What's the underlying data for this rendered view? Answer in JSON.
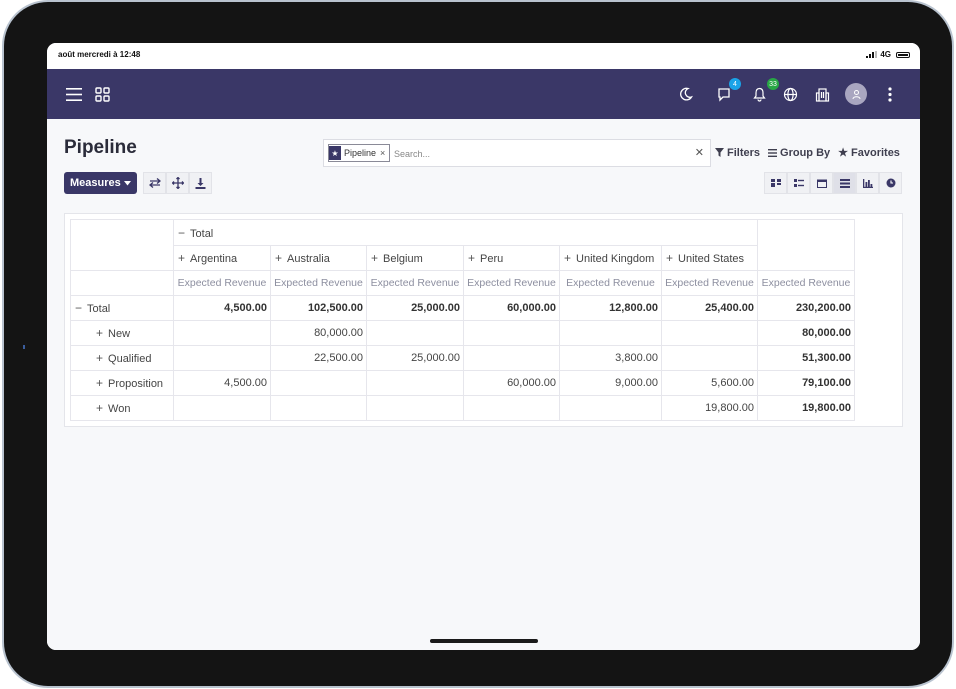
{
  "status_bar": {
    "time": "août mercredi à 12:48",
    "network": "4G"
  },
  "navbar": {
    "menu_icon": "hamburger-icon",
    "apps_icon": "grid-apps-icon",
    "moon_icon": "moon-icon",
    "chat_badge": "4",
    "notification_badge": "33",
    "colors": {
      "navbar_bg": "#3a3767",
      "chat_badge": "#1aa3e8",
      "notification_badge": "#28a745"
    }
  },
  "page": {
    "title": "Pipeline",
    "search": {
      "facet_label": "Pipeline",
      "placeholder": "Search..."
    },
    "controls": {
      "filters": "Filters",
      "group_by": "Group By",
      "favorites": "Favorites"
    },
    "measures_label": "Measures"
  },
  "pivot": {
    "total_header": "Total",
    "columns": [
      "Argentina",
      "Australia",
      "Belgium",
      "Peru",
      "United Kingdom",
      "United States"
    ],
    "measure": "Expected Revenue",
    "total_row": {
      "label": "Total",
      "values": [
        "4,500.00",
        "102,500.00",
        "25,000.00",
        "60,000.00",
        "12,800.00",
        "25,400.00"
      ],
      "total": "230,200.00"
    },
    "rows": [
      {
        "label": "New",
        "values": [
          "",
          "80,000.00",
          "",
          "",
          "",
          ""
        ],
        "total": "80,000.00"
      },
      {
        "label": "Qualified",
        "values": [
          "",
          "22,500.00",
          "25,000.00",
          "",
          "3,800.00",
          ""
        ],
        "total": "51,300.00"
      },
      {
        "label": "Proposition",
        "values": [
          "4,500.00",
          "",
          "",
          "60,000.00",
          "9,000.00",
          "5,600.00"
        ],
        "total": "79,100.00"
      },
      {
        "label": "Won",
        "values": [
          "",
          "",
          "",
          "",
          "",
          "19,800.00"
        ],
        "total": "19,800.00"
      }
    ]
  }
}
